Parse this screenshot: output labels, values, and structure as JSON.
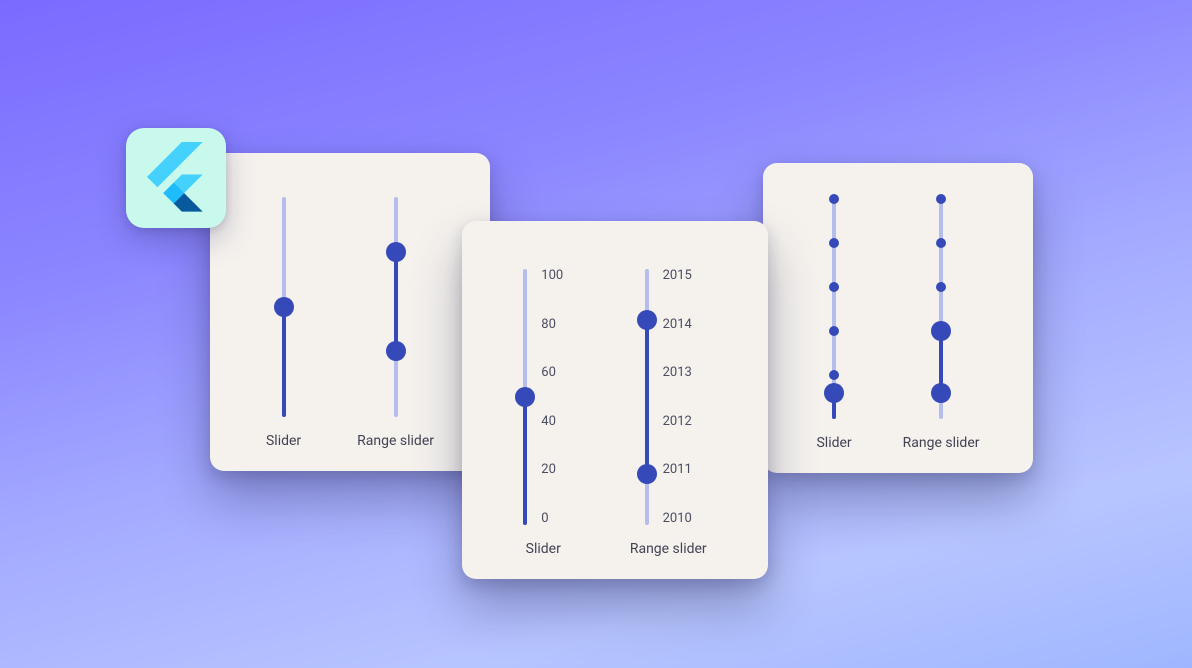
{
  "flutter_icon": "flutter-logo",
  "cards": {
    "card1": {
      "slider": {
        "label": "Slider",
        "value_percent": 50
      },
      "range_slider": {
        "label": "Range slider",
        "low_percent": 30,
        "high_percent": 75
      }
    },
    "card2": {
      "slider": {
        "label": "Slider",
        "value_percent": 50,
        "ticks": [
          "100",
          "80",
          "60",
          "40",
          "20",
          "0"
        ]
      },
      "range_slider": {
        "label": "Range slider",
        "low_percent": 20,
        "high_percent": 80,
        "ticks": [
          "2015",
          "2014",
          "2013",
          "2012",
          "2011",
          "2010"
        ]
      }
    },
    "card3": {
      "slider": {
        "label": "Slider",
        "value_percent": 12,
        "tick_count": 6
      },
      "range_slider": {
        "label": "Range slider",
        "low_percent": 12,
        "high_percent": 40,
        "tick_count": 6
      }
    }
  },
  "colors": {
    "accent": "#3649b8",
    "track": "#b5bcee",
    "card_bg": "#f5f2ee"
  }
}
